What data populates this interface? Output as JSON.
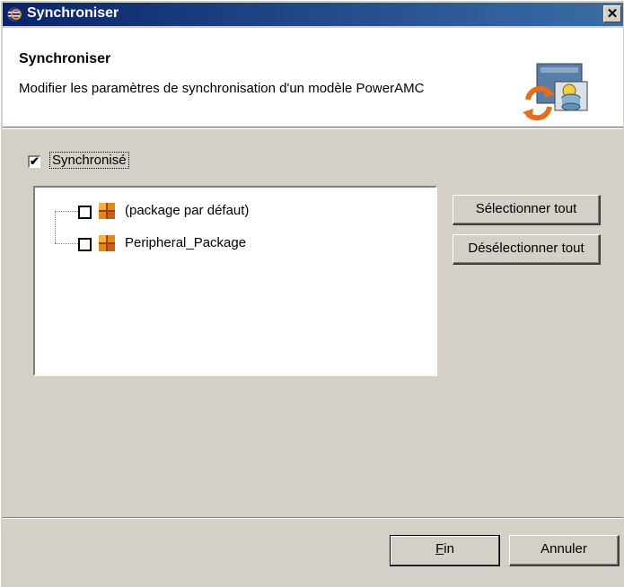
{
  "window": {
    "title": "Synchroniser",
    "close_glyph": "✕"
  },
  "header": {
    "title": "Synchroniser",
    "description": "Modifier les paramètres de synchronisation d'un modèle PowerAMC",
    "icon": "sync-database-icon"
  },
  "synchronized": {
    "label": "Synchronisé",
    "checked": true
  },
  "tree": {
    "items": [
      {
        "label": "(package par défaut)",
        "checked": false,
        "icon": "package-icon"
      },
      {
        "label": "Peripheral_Package",
        "checked": false,
        "icon": "package-icon"
      }
    ]
  },
  "buttons": {
    "select_all": "Sélectionner tout",
    "deselect_all": "Désélectionner tout",
    "finish_mnemonic": "F",
    "finish_rest": "in",
    "cancel": "Annuler"
  },
  "colors": {
    "titlebar_start": "#0a246a",
    "titlebar_end": "#3a6ea5",
    "dialog_bg": "#d4d0c8",
    "package_icon": "#e08a1e"
  }
}
